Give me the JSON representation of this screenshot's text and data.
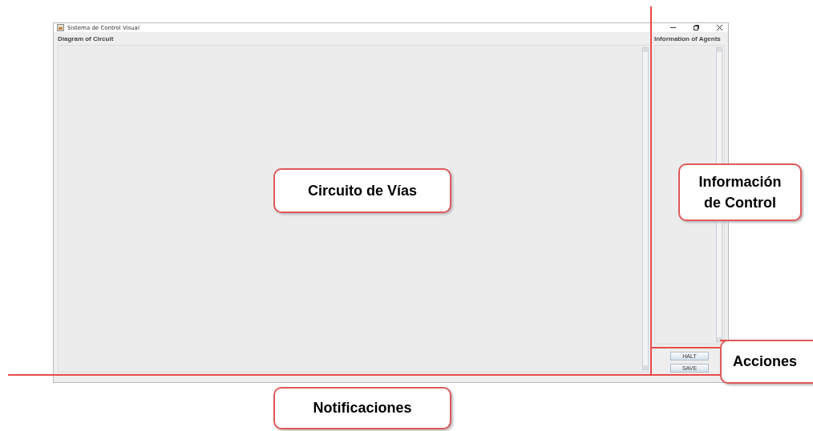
{
  "window": {
    "title": "Sistema de Control Visual"
  },
  "diagram_panel": {
    "label": "Diagram of Circuit"
  },
  "agents_panel": {
    "label": "Information of Agents"
  },
  "buttons": [
    "HALT",
    "SAVE"
  ],
  "callouts": [
    {
      "text": "Circuito de Vías"
    },
    {
      "text": "Información de Control"
    },
    {
      "text": "Acciones"
    },
    {
      "text": "Notificaciones"
    }
  ]
}
